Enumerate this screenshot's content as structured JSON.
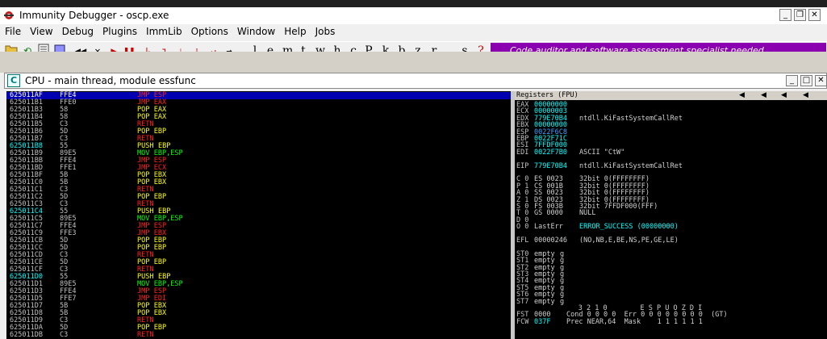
{
  "window": {
    "title": "Immunity Debugger - oscp.exe"
  },
  "menu": [
    "File",
    "View",
    "Debug",
    "Plugins",
    "ImmLib",
    "Options",
    "Window",
    "Help",
    "Jobs"
  ],
  "toolbar": {
    "letters": [
      "l",
      "e",
      "m",
      "t",
      "w",
      "h",
      "c",
      "P",
      "k",
      "b",
      "z",
      "r",
      "...",
      "s",
      "?"
    ],
    "banner": "Code auditor and software assessment specialist needed"
  },
  "cpu": {
    "title": "CPU - main thread, module essfunc"
  },
  "disasm": [
    {
      "addr": "625011AF",
      "hex": "FFE4",
      "op": "JMP",
      "arg": "ESP",
      "kind": "jmp",
      "sel": true
    },
    {
      "addr": "625011B1",
      "hex": "FFE0",
      "op": "JMP",
      "arg": "EAX",
      "kind": "jmp"
    },
    {
      "addr": "625011B3",
      "hex": "58",
      "op": "POP",
      "arg": "EAX",
      "kind": "pop"
    },
    {
      "addr": "625011B4",
      "hex": "58",
      "op": "POP",
      "arg": "EAX",
      "kind": "pop"
    },
    {
      "addr": "625011B5",
      "hex": "C3",
      "op": "RETN",
      "arg": "",
      "kind": "ret"
    },
    {
      "addr": "625011B6",
      "hex": "5D",
      "op": "POP",
      "arg": "EBP",
      "kind": "pop"
    },
    {
      "addr": "625011B7",
      "hex": "C3",
      "op": "RETN",
      "arg": "",
      "kind": "ret"
    },
    {
      "addr": "625011B8",
      "hex": "55",
      "op": "PUSH",
      "arg": "EBP",
      "kind": "push",
      "target": true
    },
    {
      "addr": "625011B9",
      "hex": "89E5",
      "op": "MOV",
      "arg": "EBP,ESP",
      "kind": "mov"
    },
    {
      "addr": "625011BB",
      "hex": "FFE4",
      "op": "JMP",
      "arg": "ESP",
      "kind": "jmp"
    },
    {
      "addr": "625011BD",
      "hex": "FFE1",
      "op": "JMP",
      "arg": "ECX",
      "kind": "jmp"
    },
    {
      "addr": "625011BF",
      "hex": "5B",
      "op": "POP",
      "arg": "EBX",
      "kind": "pop"
    },
    {
      "addr": "625011C0",
      "hex": "5B",
      "op": "POP",
      "arg": "EBX",
      "kind": "pop"
    },
    {
      "addr": "625011C1",
      "hex": "C3",
      "op": "RETN",
      "arg": "",
      "kind": "ret"
    },
    {
      "addr": "625011C2",
      "hex": "5D",
      "op": "POP",
      "arg": "EBP",
      "kind": "pop"
    },
    {
      "addr": "625011C3",
      "hex": "C3",
      "op": "RETN",
      "arg": "",
      "kind": "ret"
    },
    {
      "addr": "625011C4",
      "hex": "55",
      "op": "PUSH",
      "arg": "EBP",
      "kind": "push",
      "target": true
    },
    {
      "addr": "625011C5",
      "hex": "89E5",
      "op": "MOV",
      "arg": "EBP,ESP",
      "kind": "mov"
    },
    {
      "addr": "625011C7",
      "hex": "FFE4",
      "op": "JMP",
      "arg": "ESP",
      "kind": "jmp"
    },
    {
      "addr": "625011C9",
      "hex": "FFE3",
      "op": "JMP",
      "arg": "EBX",
      "kind": "jmp"
    },
    {
      "addr": "625011CB",
      "hex": "5D",
      "op": "POP",
      "arg": "EBP",
      "kind": "pop"
    },
    {
      "addr": "625011CC",
      "hex": "5D",
      "op": "POP",
      "arg": "EBP",
      "kind": "pop"
    },
    {
      "addr": "625011CD",
      "hex": "C3",
      "op": "RETN",
      "arg": "",
      "kind": "ret"
    },
    {
      "addr": "625011CE",
      "hex": "5D",
      "op": "POP",
      "arg": "EBP",
      "kind": "pop"
    },
    {
      "addr": "625011CF",
      "hex": "C3",
      "op": "RETN",
      "arg": "",
      "kind": "ret"
    },
    {
      "addr": "625011D0",
      "hex": "55",
      "op": "PUSH",
      "arg": "EBP",
      "kind": "push",
      "target": true
    },
    {
      "addr": "625011D1",
      "hex": "89E5",
      "op": "MOV",
      "arg": "EBP,ESP",
      "kind": "mov"
    },
    {
      "addr": "625011D3",
      "hex": "FFE4",
      "op": "JMP",
      "arg": "ESP",
      "kind": "jmp"
    },
    {
      "addr": "625011D5",
      "hex": "FFE7",
      "op": "JMP",
      "arg": "EDI",
      "kind": "jmp"
    },
    {
      "addr": "625011D7",
      "hex": "5B",
      "op": "POP",
      "arg": "EBX",
      "kind": "pop"
    },
    {
      "addr": "625011D8",
      "hex": "5B",
      "op": "POP",
      "arg": "EBX",
      "kind": "pop"
    },
    {
      "addr": "625011D9",
      "hex": "C3",
      "op": "RETN",
      "arg": "",
      "kind": "ret"
    },
    {
      "addr": "625011DA",
      "hex": "5D",
      "op": "POP",
      "arg": "EBP",
      "kind": "pop"
    },
    {
      "addr": "625011DB",
      "hex": "C3",
      "op": "RETN",
      "arg": "",
      "kind": "ret"
    }
  ],
  "registers": {
    "title": "Registers (FPU)",
    "lines": [
      {
        "k": "EAX",
        "v": "00000000",
        "c": "cyan",
        "t": ""
      },
      {
        "k": "ECX",
        "v": "00000003",
        "c": "cyan",
        "t": ""
      },
      {
        "k": "EDX",
        "v": "779E70B4",
        "c": "cyan",
        "t": "ntdll.KiFastSystemCallRet"
      },
      {
        "k": "EBX",
        "v": "00000000",
        "c": "cyan",
        "t": ""
      },
      {
        "k": "ESP",
        "v": "0022F6C8",
        "c": "blue",
        "t": ""
      },
      {
        "k": "EBP",
        "v": "0022F71C",
        "c": "cyan",
        "t": ""
      },
      {
        "k": "ESI",
        "v": "7FFDF000",
        "c": "cyan",
        "t": ""
      },
      {
        "k": "EDI",
        "v": "0022F7B0",
        "c": "cyan",
        "t": "ASCII \"CtW\""
      },
      {
        "k": "",
        "v": "",
        "c": "",
        "t": ""
      },
      {
        "k": "EIP",
        "v": "779E70B4",
        "c": "cyan",
        "t": "ntdll.KiFastSystemCallRet"
      },
      {
        "k": "",
        "v": "",
        "c": "",
        "t": ""
      },
      {
        "k": "C 0",
        "v": "ES 0023",
        "c": "light",
        "t": "32bit 0(FFFFFFFF)"
      },
      {
        "k": "P 1",
        "v": "CS 001B",
        "c": "light",
        "t": "32bit 0(FFFFFFFF)"
      },
      {
        "k": "A 0",
        "v": "SS 0023",
        "c": "light",
        "t": "32bit 0(FFFFFFFF)"
      },
      {
        "k": "Z 1",
        "v": "DS 0023",
        "c": "light",
        "t": "32bit 0(FFFFFFFF)"
      },
      {
        "k": "S 0",
        "v": "FS 003B",
        "c": "light",
        "t": "32bit 7FFDF000(FFF)"
      },
      {
        "k": "T 0",
        "v": "GS 0000",
        "c": "light",
        "t": "NULL"
      },
      {
        "k": "D 0",
        "v": "",
        "c": "",
        "t": ""
      },
      {
        "k": "O 0",
        "v": "LastErr",
        "c": "light",
        "t": "ERROR_SUCCESS (00000000)"
      },
      {
        "k": "",
        "v": "",
        "c": "",
        "t": ""
      },
      {
        "k": "EFL",
        "v": "00000246",
        "c": "light",
        "t": "(NO,NB,E,BE,NS,PE,GE,LE)"
      },
      {
        "k": "",
        "v": "",
        "c": "",
        "t": ""
      },
      {
        "k": "ST0",
        "v": "empty",
        "c": "light",
        "t": "g"
      },
      {
        "k": "ST1",
        "v": "empty",
        "c": "light",
        "t": "g"
      },
      {
        "k": "ST2",
        "v": "empty",
        "c": "light",
        "t": "g"
      },
      {
        "k": "ST3",
        "v": "empty",
        "c": "light",
        "t": "g"
      },
      {
        "k": "ST4",
        "v": "empty",
        "c": "light",
        "t": "g"
      },
      {
        "k": "ST5",
        "v": "empty",
        "c": "light",
        "t": "g"
      },
      {
        "k": "ST6",
        "v": "empty",
        "c": "light",
        "t": "g"
      },
      {
        "k": "ST7",
        "v": "empty",
        "c": "light",
        "t": "g"
      },
      {
        "k": "",
        "v": "",
        "c": "",
        "t": "               3 2 1 0        E S P U O Z D I"
      },
      {
        "k": "FST",
        "v": "0000",
        "c": "light",
        "t": "Cond 0 0 0 0  Err 0 0 0 0 0 0 0 0  (GT)"
      },
      {
        "k": "FCW",
        "v": "037F",
        "c": "cyan",
        "t": "Prec NEAR,64  Mask    1 1 1 1 1 1"
      }
    ]
  },
  "colors": {
    "banner": "#8a00b0",
    "jmp": "#ff2020",
    "pop": "#ffff00",
    "mov": "#00ff00",
    "selection": "#0000b0"
  }
}
